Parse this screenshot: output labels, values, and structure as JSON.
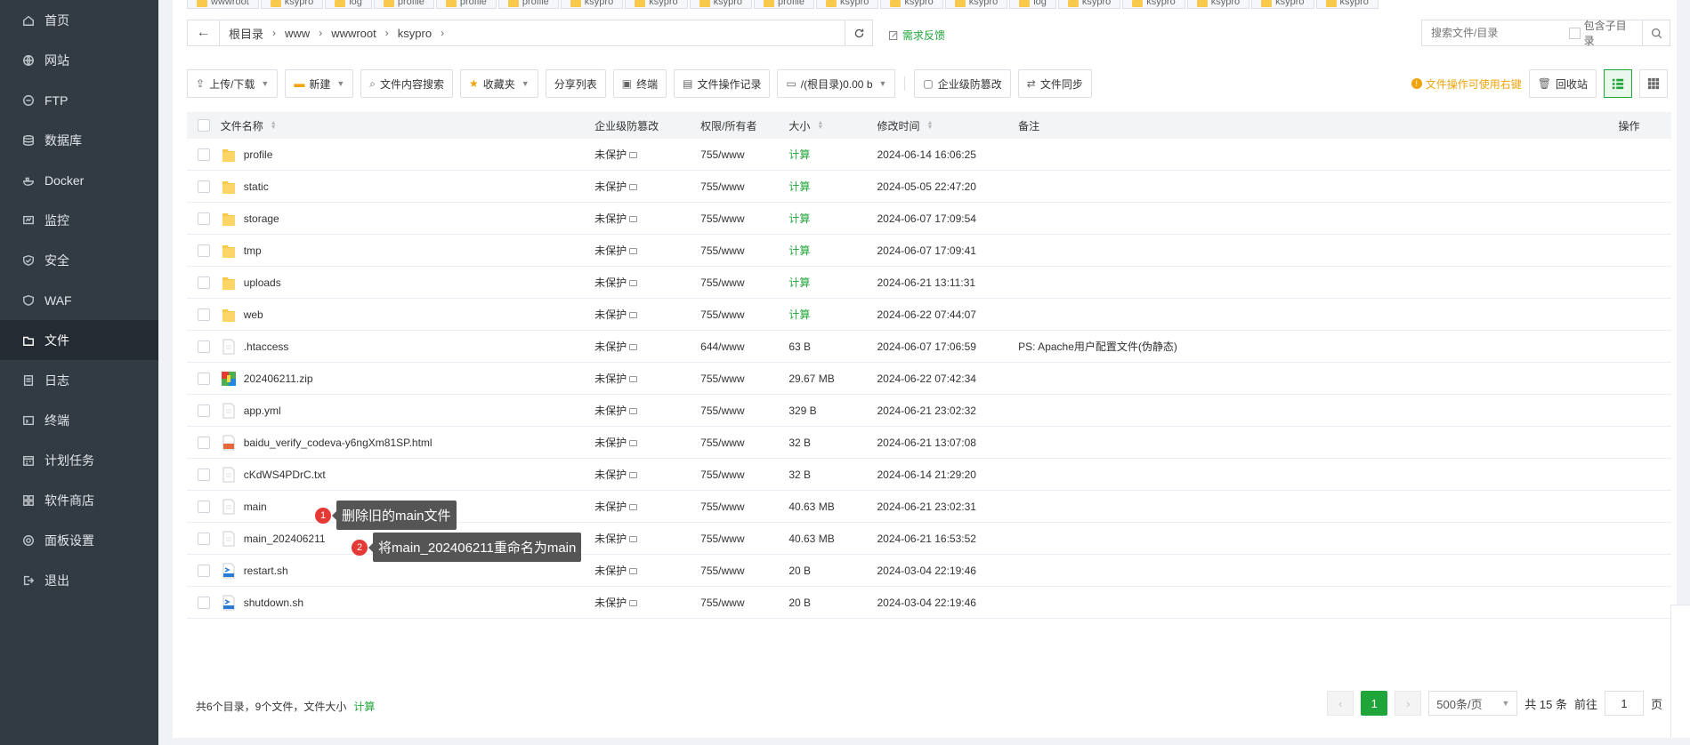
{
  "sidebar": {
    "items": [
      {
        "label": "首页",
        "icon": "home-icon"
      },
      {
        "label": "网站",
        "icon": "globe-icon"
      },
      {
        "label": "FTP",
        "icon": "ftp-icon"
      },
      {
        "label": "数据库",
        "icon": "database-icon"
      },
      {
        "label": "Docker",
        "icon": "docker-icon"
      },
      {
        "label": "监控",
        "icon": "monitor-icon"
      },
      {
        "label": "安全",
        "icon": "shield-icon"
      },
      {
        "label": "WAF",
        "icon": "waf-icon"
      },
      {
        "label": "文件",
        "icon": "folder-icon",
        "active": true
      },
      {
        "label": "日志",
        "icon": "log-icon"
      },
      {
        "label": "终端",
        "icon": "terminal-icon"
      },
      {
        "label": "计划任务",
        "icon": "calendar-icon"
      },
      {
        "label": "软件商店",
        "icon": "apps-icon"
      },
      {
        "label": "面板设置",
        "icon": "gear-icon"
      },
      {
        "label": "退出",
        "icon": "logout-icon"
      }
    ]
  },
  "tabs": [
    "wwwroot",
    "ksypro",
    "log",
    "profile",
    "profile",
    "profile",
    "ksypro",
    "ksypro",
    "ksypro",
    "profile",
    "ksypro",
    "ksypro",
    "ksypro",
    "log",
    "ksypro",
    "ksypro",
    "ksypro",
    "ksypro",
    "ksypro"
  ],
  "path": {
    "segments": [
      "根目录",
      "www",
      "wwwroot",
      "ksypro"
    ],
    "feedback": "需求反馈"
  },
  "search": {
    "placeholder": "搜索文件/目录",
    "include_sub": "包含子目录"
  },
  "toolbar": {
    "upload": "上传/下载",
    "new": "新建",
    "content_search": "文件内容搜索",
    "favorites": "收藏夹",
    "share_list": "分享列表",
    "terminal": "终端",
    "op_log": "文件操作记录",
    "disk": "/(根目录)0.00 b",
    "enterprise_guard": "企业级防篡改",
    "file_sync": "文件同步",
    "tip": "文件操作可使用右键",
    "recycle": "回收站"
  },
  "table": {
    "headers": {
      "name": "文件名称",
      "guard": "企业级防篡改",
      "perm": "权限/所有者",
      "size": "大小",
      "mtime": "修改时间",
      "note": "备注",
      "op": "操作"
    },
    "rows": [
      {
        "name": "profile",
        "type": "folder",
        "guard": "未保护",
        "perm": "755/www",
        "size": "计算",
        "mtime": "2024-06-14 16:06:25",
        "note": ""
      },
      {
        "name": "static",
        "type": "folder",
        "guard": "未保护",
        "perm": "755/www",
        "size": "计算",
        "mtime": "2024-05-05 22:47:20",
        "note": ""
      },
      {
        "name": "storage",
        "type": "folder",
        "guard": "未保护",
        "perm": "755/www",
        "size": "计算",
        "mtime": "2024-06-07 17:09:54",
        "note": ""
      },
      {
        "name": "tmp",
        "type": "folder",
        "guard": "未保护",
        "perm": "755/www",
        "size": "计算",
        "mtime": "2024-06-07 17:09:41",
        "note": ""
      },
      {
        "name": "uploads",
        "type": "folder",
        "guard": "未保护",
        "perm": "755/www",
        "size": "计算",
        "mtime": "2024-06-21 13:11:31",
        "note": ""
      },
      {
        "name": "web",
        "type": "folder",
        "guard": "未保护",
        "perm": "755/www",
        "size": "计算",
        "mtime": "2024-06-22 07:44:07",
        "note": ""
      },
      {
        "name": ".htaccess",
        "type": "file",
        "guard": "未保护",
        "perm": "644/www",
        "size": "63 B",
        "mtime": "2024-06-07 17:06:59",
        "note": "PS: Apache用户配置文件(伪静态)"
      },
      {
        "name": "202406211.zip",
        "type": "zip",
        "guard": "未保护",
        "perm": "755/www",
        "size": "29.67 MB",
        "mtime": "2024-06-22 07:42:34",
        "note": ""
      },
      {
        "name": "app.yml",
        "type": "file",
        "guard": "未保护",
        "perm": "755/www",
        "size": "329 B",
        "mtime": "2024-06-21 23:02:32",
        "note": ""
      },
      {
        "name": "baidu_verify_codeva-y6ngXm81SP.html",
        "type": "html",
        "guard": "未保护",
        "perm": "755/www",
        "size": "32 B",
        "mtime": "2024-06-21 13:07:08",
        "note": ""
      },
      {
        "name": "cKdWS4PDrC.txt",
        "type": "file",
        "guard": "未保护",
        "perm": "755/www",
        "size": "32 B",
        "mtime": "2024-06-14 21:29:20",
        "note": ""
      },
      {
        "name": "main",
        "type": "file",
        "guard": "未保护",
        "perm": "755/www",
        "size": "40.63 MB",
        "mtime": "2024-06-21 23:02:31",
        "note": ""
      },
      {
        "name": "main_202406211",
        "type": "file",
        "guard": "未保护",
        "perm": "755/www",
        "size": "40.63 MB",
        "mtime": "2024-06-21 16:53:52",
        "note": ""
      },
      {
        "name": "restart.sh",
        "type": "shell",
        "guard": "未保护",
        "perm": "755/www",
        "size": "20 B",
        "mtime": "2024-03-04 22:19:46",
        "note": ""
      },
      {
        "name": "shutdown.sh",
        "type": "shell",
        "guard": "未保护",
        "perm": "755/www",
        "size": "20 B",
        "mtime": "2024-03-04 22:19:46",
        "note": ""
      }
    ]
  },
  "annotations": [
    {
      "num": "1",
      "text": "删除旧的main文件"
    },
    {
      "num": "2",
      "text": "将main_202406211重命名为main"
    }
  ],
  "footer": {
    "summary": "共6个目录，9个文件，文件大小",
    "calc": "计算",
    "page": "1",
    "page_size": "500条/页",
    "total": "共 15 条",
    "goto_label": "前往",
    "goto_value": "1",
    "page_unit": "页"
  },
  "colors": {
    "accent": "#20a53a",
    "sidebar_bg": "#323a44",
    "warning": "#f0a30a",
    "annotation_badge": "#e53935"
  }
}
